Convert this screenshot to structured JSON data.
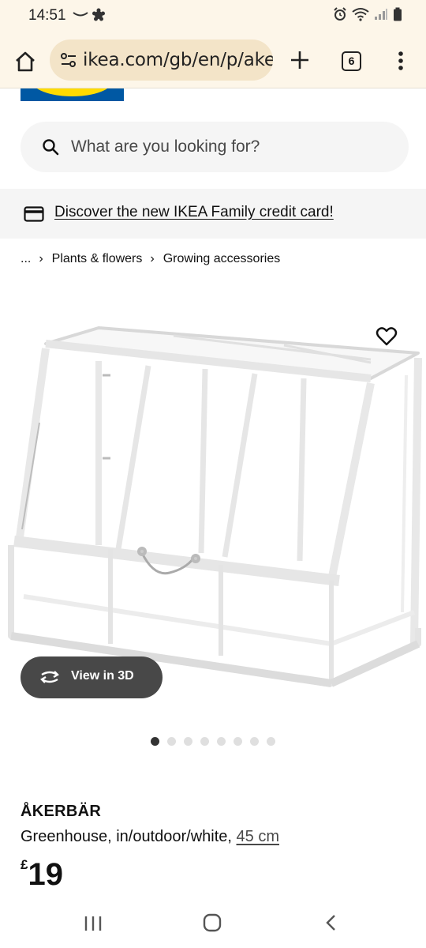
{
  "status_bar": {
    "time": "14:51"
  },
  "browser": {
    "url": "ikea.com/gb/en/p/ake",
    "tab_count": "6"
  },
  "search": {
    "placeholder": "What are you looking for?"
  },
  "promo": {
    "link_text": "Discover the new IKEA Family credit card!"
  },
  "breadcrumb": {
    "ellipsis": "...",
    "items": [
      "Plants & flowers",
      "Growing accessories"
    ]
  },
  "media": {
    "view_3d_label": "View in 3D",
    "image_count": 8,
    "active_image_index": 0
  },
  "product": {
    "name": "ÅKERBÄR",
    "description": "Greenhouse, in/outdoor/white, ",
    "size": "45 cm",
    "currency": "£",
    "price": "19"
  },
  "colors": {
    "browser_bg": "#fdf6e9",
    "url_pill": "#f3e4c8",
    "ikea_blue": "#0058a3",
    "ikea_yellow": "#ffdb00",
    "button_dark": "#484848"
  }
}
